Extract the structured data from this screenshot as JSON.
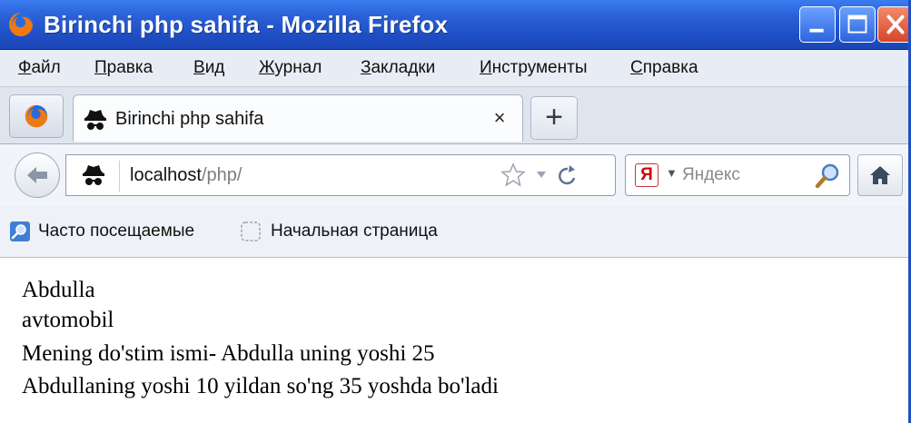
{
  "window": {
    "title": "Birinchi php sahifa - Mozilla Firefox"
  },
  "menu": {
    "items": [
      {
        "label_u": "Ф",
        "label_rest": "айл"
      },
      {
        "label_u": "П",
        "label_rest": "равка"
      },
      {
        "label_u": "В",
        "label_rest": "ид"
      },
      {
        "label_u": "Ж",
        "label_rest": "урнал"
      },
      {
        "label_u": "З",
        "label_rest": "акладки"
      },
      {
        "label_u": "И",
        "label_rest": "нструменты"
      },
      {
        "label_u": "С",
        "label_rest": "правка"
      }
    ]
  },
  "tab": {
    "label": "Birinchi php sahifa",
    "close": "×"
  },
  "newtab": {
    "label": "+"
  },
  "address": {
    "host": "localhost",
    "path": "/php/"
  },
  "search": {
    "engine_logo": "Я",
    "placeholder": "Яндекс"
  },
  "bookmarks": {
    "items": [
      {
        "label": "Часто посещаемые"
      },
      {
        "label": "Начальная страница"
      }
    ]
  },
  "content": {
    "lines": [
      "Abdulla",
      "avtomobil",
      "Mening do'stim ismi- Abdulla uning yoshi 25",
      "Abdullaning yoshi 10 yildan so'ng 35 yoshda bo'ladi"
    ]
  },
  "colors": {
    "titlebar": "#2a5fd6",
    "menubar": "#e8ecf4",
    "close_button": "#d8452a"
  }
}
